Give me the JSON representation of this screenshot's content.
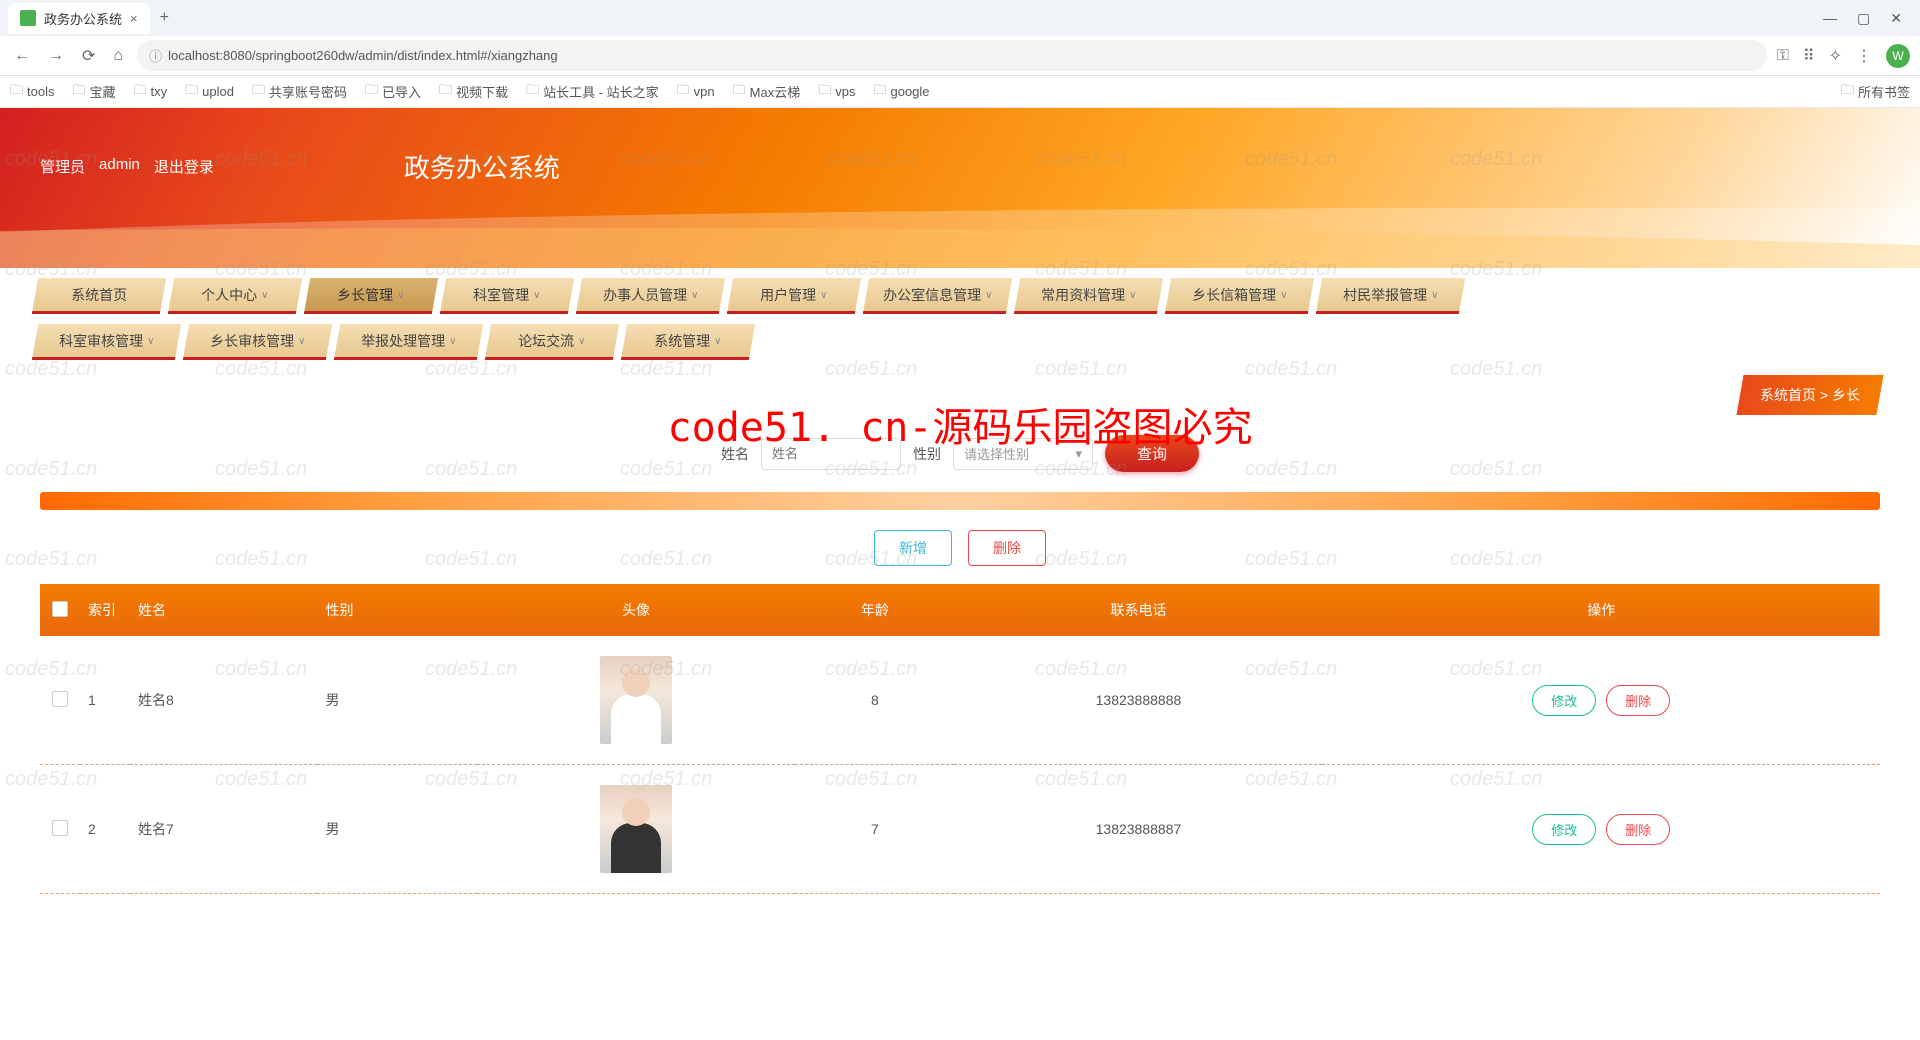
{
  "browser": {
    "tab_title": "政务办公系统",
    "url": "localhost:8080/springboot260dw/admin/dist/index.html#/xiangzhang",
    "avatar_letter": "W",
    "bookmarks": [
      "tools",
      "宝藏",
      "txy",
      "uplod",
      "共享账号密码",
      "已导入",
      "视频下载",
      "站长工具 - 站长之家",
      "vpn",
      "Max云梯",
      "vps",
      "google"
    ],
    "all_bookmarks": "所有书签"
  },
  "header": {
    "role_label": "管理员",
    "username": "admin",
    "logout": "退出登录",
    "system_title": "政务办公系统"
  },
  "nav": {
    "row1": [
      "系统首页",
      "个人中心",
      "乡长管理",
      "科室管理",
      "办事人员管理",
      "用户管理",
      "办公室信息管理",
      "常用资料管理",
      "乡长信箱管理",
      "村民举报管理"
    ],
    "row2": [
      "科室审核管理",
      "乡长审核管理",
      "举报处理管理",
      "论坛交流",
      "系统管理"
    ],
    "active": "乡长管理"
  },
  "breadcrumb": {
    "home": "系统首页",
    "sep": ">",
    "current": "乡长"
  },
  "watermark": {
    "main": "code51. cn-源码乐园盗图必究",
    "small": "code51.cn"
  },
  "search": {
    "name_label": "姓名",
    "name_placeholder": "姓名",
    "gender_label": "性别",
    "gender_placeholder": "请选择性别",
    "query_btn": "查询"
  },
  "actions": {
    "add": "新增",
    "delete": "删除"
  },
  "table": {
    "cols": {
      "index": "索引",
      "name": "姓名",
      "gender": "性别",
      "avatar": "头像",
      "age": "年龄",
      "phone": "联系电话",
      "ops": "操作"
    },
    "edit": "修改",
    "del": "删除",
    "rows": [
      {
        "idx": "1",
        "name": "姓名8",
        "gender": "男",
        "age": "8",
        "phone": "13823888888",
        "female": true
      },
      {
        "idx": "2",
        "name": "姓名7",
        "gender": "男",
        "age": "7",
        "phone": "13823888887",
        "female": false
      }
    ]
  }
}
